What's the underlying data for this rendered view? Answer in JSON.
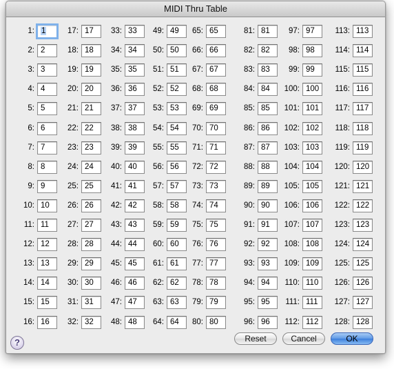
{
  "window": {
    "title": "MIDI Thru Table"
  },
  "table": {
    "entries": [
      {
        "label": "1:",
        "value": "1"
      },
      {
        "label": "2:",
        "value": "2"
      },
      {
        "label": "3:",
        "value": "3"
      },
      {
        "label": "4:",
        "value": "4"
      },
      {
        "label": "5:",
        "value": "5"
      },
      {
        "label": "6:",
        "value": "6"
      },
      {
        "label": "7:",
        "value": "7"
      },
      {
        "label": "8:",
        "value": "8"
      },
      {
        "label": "9:",
        "value": "9"
      },
      {
        "label": "10:",
        "value": "10"
      },
      {
        "label": "11:",
        "value": "11"
      },
      {
        "label": "12:",
        "value": "12"
      },
      {
        "label": "13:",
        "value": "13"
      },
      {
        "label": "14:",
        "value": "14"
      },
      {
        "label": "15:",
        "value": "15"
      },
      {
        "label": "16:",
        "value": "16"
      },
      {
        "label": "17:",
        "value": "17"
      },
      {
        "label": "18:",
        "value": "18"
      },
      {
        "label": "19:",
        "value": "19"
      },
      {
        "label": "20:",
        "value": "20"
      },
      {
        "label": "21:",
        "value": "21"
      },
      {
        "label": "22:",
        "value": "22"
      },
      {
        "label": "23:",
        "value": "23"
      },
      {
        "label": "24:",
        "value": "24"
      },
      {
        "label": "25:",
        "value": "25"
      },
      {
        "label": "26:",
        "value": "26"
      },
      {
        "label": "27:",
        "value": "27"
      },
      {
        "label": "28:",
        "value": "28"
      },
      {
        "label": "29:",
        "value": "29"
      },
      {
        "label": "30:",
        "value": "30"
      },
      {
        "label": "31:",
        "value": "31"
      },
      {
        "label": "32:",
        "value": "32"
      },
      {
        "label": "33:",
        "value": "33"
      },
      {
        "label": "34:",
        "value": "34"
      },
      {
        "label": "35:",
        "value": "35"
      },
      {
        "label": "36:",
        "value": "36"
      },
      {
        "label": "37:",
        "value": "37"
      },
      {
        "label": "38:",
        "value": "38"
      },
      {
        "label": "39:",
        "value": "39"
      },
      {
        "label": "40:",
        "value": "40"
      },
      {
        "label": "41:",
        "value": "41"
      },
      {
        "label": "42:",
        "value": "42"
      },
      {
        "label": "43:",
        "value": "43"
      },
      {
        "label": "44:",
        "value": "44"
      },
      {
        "label": "45:",
        "value": "45"
      },
      {
        "label": "46:",
        "value": "46"
      },
      {
        "label": "47:",
        "value": "47"
      },
      {
        "label": "48:",
        "value": "48"
      },
      {
        "label": "49:",
        "value": "49"
      },
      {
        "label": "50:",
        "value": "50"
      },
      {
        "label": "51:",
        "value": "51"
      },
      {
        "label": "52:",
        "value": "52"
      },
      {
        "label": "53:",
        "value": "53"
      },
      {
        "label": "54:",
        "value": "54"
      },
      {
        "label": "55:",
        "value": "55"
      },
      {
        "label": "56:",
        "value": "56"
      },
      {
        "label": "57:",
        "value": "57"
      },
      {
        "label": "58:",
        "value": "58"
      },
      {
        "label": "59:",
        "value": "59"
      },
      {
        "label": "60:",
        "value": "60"
      },
      {
        "label": "61:",
        "value": "61"
      },
      {
        "label": "62:",
        "value": "62"
      },
      {
        "label": "63:",
        "value": "63"
      },
      {
        "label": "64:",
        "value": "64"
      },
      {
        "label": "65:",
        "value": "65"
      },
      {
        "label": "66:",
        "value": "66"
      },
      {
        "label": "67:",
        "value": "67"
      },
      {
        "label": "68:",
        "value": "68"
      },
      {
        "label": "69:",
        "value": "69"
      },
      {
        "label": "70:",
        "value": "70"
      },
      {
        "label": "71:",
        "value": "71"
      },
      {
        "label": "72:",
        "value": "72"
      },
      {
        "label": "73:",
        "value": "73"
      },
      {
        "label": "74:",
        "value": "74"
      },
      {
        "label": "75:",
        "value": "75"
      },
      {
        "label": "76:",
        "value": "76"
      },
      {
        "label": "77:",
        "value": "77"
      },
      {
        "label": "78:",
        "value": "78"
      },
      {
        "label": "79:",
        "value": "79"
      },
      {
        "label": "80:",
        "value": "80"
      },
      {
        "label": "81:",
        "value": "81"
      },
      {
        "label": "82:",
        "value": "82"
      },
      {
        "label": "83:",
        "value": "83"
      },
      {
        "label": "84:",
        "value": "84"
      },
      {
        "label": "85:",
        "value": "85"
      },
      {
        "label": "86:",
        "value": "86"
      },
      {
        "label": "87:",
        "value": "87"
      },
      {
        "label": "88:",
        "value": "88"
      },
      {
        "label": "89:",
        "value": "89"
      },
      {
        "label": "90:",
        "value": "90"
      },
      {
        "label": "91:",
        "value": "91"
      },
      {
        "label": "92:",
        "value": "92"
      },
      {
        "label": "93:",
        "value": "93"
      },
      {
        "label": "94:",
        "value": "94"
      },
      {
        "label": "95:",
        "value": "95"
      },
      {
        "label": "96:",
        "value": "96"
      },
      {
        "label": "97:",
        "value": "97"
      },
      {
        "label": "98:",
        "value": "98"
      },
      {
        "label": "99:",
        "value": "99"
      },
      {
        "label": "100:",
        "value": "100"
      },
      {
        "label": "101:",
        "value": "101"
      },
      {
        "label": "102:",
        "value": "102"
      },
      {
        "label": "103:",
        "value": "103"
      },
      {
        "label": "104:",
        "value": "104"
      },
      {
        "label": "105:",
        "value": "105"
      },
      {
        "label": "106:",
        "value": "106"
      },
      {
        "label": "107:",
        "value": "107"
      },
      {
        "label": "108:",
        "value": "108"
      },
      {
        "label": "109:",
        "value": "109"
      },
      {
        "label": "110:",
        "value": "110"
      },
      {
        "label": "111:",
        "value": "111"
      },
      {
        "label": "112:",
        "value": "112"
      },
      {
        "label": "113:",
        "value": "113"
      },
      {
        "label": "114:",
        "value": "114"
      },
      {
        "label": "115:",
        "value": "115"
      },
      {
        "label": "116:",
        "value": "116"
      },
      {
        "label": "117:",
        "value": "117"
      },
      {
        "label": "118:",
        "value": "118"
      },
      {
        "label": "119:",
        "value": "119"
      },
      {
        "label": "120:",
        "value": "120"
      },
      {
        "label": "121:",
        "value": "121"
      },
      {
        "label": "122:",
        "value": "122"
      },
      {
        "label": "123:",
        "value": "123"
      },
      {
        "label": "124:",
        "value": "124"
      },
      {
        "label": "125:",
        "value": "125"
      },
      {
        "label": "126:",
        "value": "126"
      },
      {
        "label": "127:",
        "value": "127"
      },
      {
        "label": "128:",
        "value": "128"
      }
    ]
  },
  "buttons": {
    "help": "?",
    "reset": "Reset",
    "cancel": "Cancel",
    "ok": "OK"
  },
  "colors": {
    "accent": "#3c7fdc",
    "focus_ring": "#7fb1ea"
  }
}
